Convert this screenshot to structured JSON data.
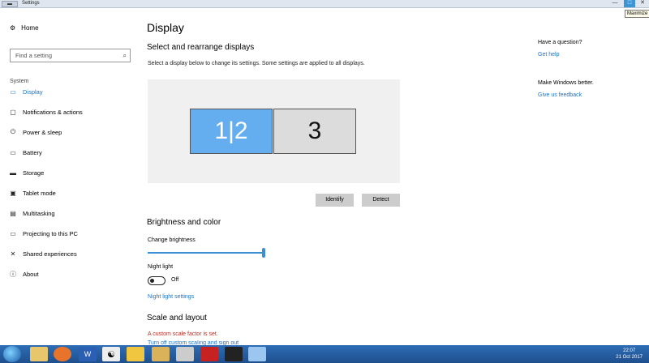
{
  "window": {
    "title": "Settings",
    "min_glyph": "—",
    "max_glyph": "□",
    "close_glyph": "✕",
    "tooltip": "Maximize"
  },
  "sidebar": {
    "home": "Home",
    "search_placeholder": "Find a setting",
    "section": "System",
    "items": [
      {
        "label": "Display",
        "icon": "monitor-icon",
        "glyph": "▭"
      },
      {
        "label": "Notifications & actions",
        "icon": "notifications-icon",
        "glyph": "▢"
      },
      {
        "label": "Power & sleep",
        "icon": "power-icon",
        "glyph": "⏻"
      },
      {
        "label": "Battery",
        "icon": "battery-icon",
        "glyph": "▭"
      },
      {
        "label": "Storage",
        "icon": "storage-icon",
        "glyph": "▬"
      },
      {
        "label": "Tablet mode",
        "icon": "tablet-icon",
        "glyph": "▣"
      },
      {
        "label": "Multitasking",
        "icon": "multitasking-icon",
        "glyph": "▤"
      },
      {
        "label": "Projecting to this PC",
        "icon": "project-icon",
        "glyph": "▭"
      },
      {
        "label": "Shared experiences",
        "icon": "shared-icon",
        "glyph": "✕"
      },
      {
        "label": "About",
        "icon": "info-icon",
        "glyph": "ⓘ"
      }
    ]
  },
  "main": {
    "title": "Display",
    "arrange_heading": "Select and rearrange displays",
    "arrange_desc": "Select a display below to change its settings. Some settings are applied to all displays.",
    "monitor_primary": "1|2",
    "monitor_secondary": "3",
    "identify_label": "Identify",
    "detect_label": "Detect",
    "brightness_heading": "Brightness and color",
    "brightness_label": "Change brightness",
    "brightness_level": 100,
    "night_light_label": "Night light",
    "night_light_state": "Off",
    "night_light_settings": "Night light settings",
    "scale_heading": "Scale and layout",
    "scale_warning": "A custom scale factor is set.",
    "scale_link": "Turn off custom scaling and sign out"
  },
  "right": {
    "question": "Have a question?",
    "get_help": "Get help",
    "better": "Make Windows better.",
    "feedback": "Give us feedback"
  },
  "taskbar": {
    "time": "22:07",
    "date": "21 Oct 2017"
  }
}
